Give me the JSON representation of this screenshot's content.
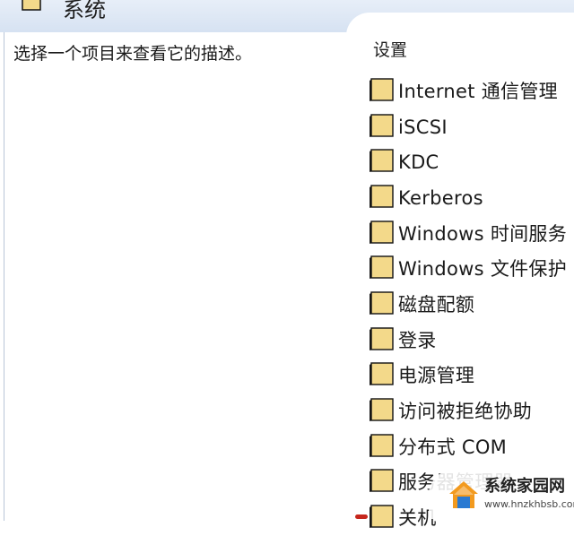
{
  "header": {
    "title": "系统",
    "icon": "folder-icon"
  },
  "left_pane": {
    "description_prompt": "选择一个项目来查看它的描述。"
  },
  "right_pane": {
    "section_header": "设置",
    "items": [
      {
        "label": "Internet 通信管理",
        "icon": "folder-icon"
      },
      {
        "label": "iSCSI",
        "icon": "folder-icon"
      },
      {
        "label": "KDC",
        "icon": "folder-icon"
      },
      {
        "label": "Kerberos",
        "icon": "folder-icon"
      },
      {
        "label": "Windows 时间服务",
        "icon": "folder-icon"
      },
      {
        "label": "Windows 文件保护",
        "icon": "folder-icon"
      },
      {
        "label": "磁盘配额",
        "icon": "folder-icon"
      },
      {
        "label": "登录",
        "icon": "folder-icon"
      },
      {
        "label": "电源管理",
        "icon": "folder-icon"
      },
      {
        "label": "访问被拒绝协助",
        "icon": "folder-icon"
      },
      {
        "label": "分布式 COM",
        "icon": "folder-icon"
      },
      {
        "label": "服务器管理器",
        "icon": "folder-icon"
      },
      {
        "label": "关机",
        "icon": "folder-icon"
      }
    ]
  },
  "watermark": {
    "title": "系统家园网",
    "url": "www.hnzkhbsb.com",
    "logo": "house-logo-icon"
  },
  "colors": {
    "folder_fill": "#f3d98a",
    "folder_border": "#111111",
    "header_bg": "#dce6f3",
    "pane_border": "#b9c6d8",
    "logo_orange": "#f29a1f",
    "logo_blue": "#2a7ad2"
  }
}
